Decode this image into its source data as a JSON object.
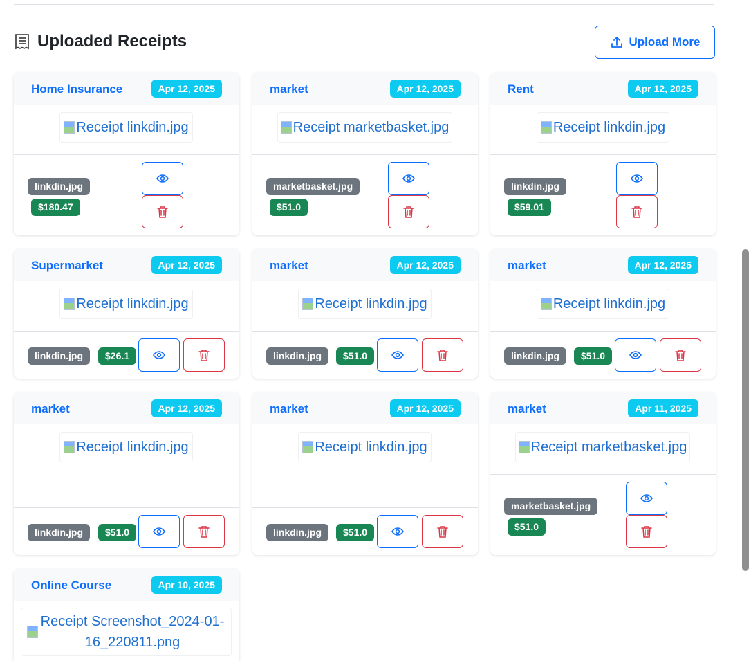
{
  "header": {
    "title": "Uploaded Receipts",
    "upload_label": "Upload More"
  },
  "cards": [
    {
      "title": "Home Insurance",
      "date": "Apr 12, 2025",
      "image_alt": "Receipt linkdin.jpg",
      "file": "linkdin.jpg",
      "amount": "$180.47"
    },
    {
      "title": "market",
      "date": "Apr 12, 2025",
      "image_alt": "Receipt marketbasket.jpg",
      "file": "marketbasket.jpg",
      "amount": "$51.0"
    },
    {
      "title": "Rent",
      "date": "Apr 12, 2025",
      "image_alt": "Receipt linkdin.jpg",
      "file": "linkdin.jpg",
      "amount": "$59.01"
    },
    {
      "title": "Supermarket",
      "date": "Apr 12, 2025",
      "image_alt": "Receipt linkdin.jpg",
      "file": "linkdin.jpg",
      "amount": "$26.1"
    },
    {
      "title": "market",
      "date": "Apr 12, 2025",
      "image_alt": "Receipt linkdin.jpg",
      "file": "linkdin.jpg",
      "amount": "$51.0"
    },
    {
      "title": "market",
      "date": "Apr 12, 2025",
      "image_alt": "Receipt linkdin.jpg",
      "file": "linkdin.jpg",
      "amount": "$51.0"
    },
    {
      "title": "market",
      "date": "Apr 12, 2025",
      "image_alt": "Receipt linkdin.jpg",
      "file": "linkdin.jpg",
      "amount": "$51.0"
    },
    {
      "title": "market",
      "date": "Apr 12, 2025",
      "image_alt": "Receipt linkdin.jpg",
      "file": "linkdin.jpg",
      "amount": "$51.0"
    },
    {
      "title": "market",
      "date": "Apr 11, 2025",
      "image_alt": "Receipt marketbasket.jpg",
      "file": "marketbasket.jpg",
      "amount": "$51.0"
    },
    {
      "title": "Online Course",
      "date": "Apr 10, 2025",
      "image_alt": "Receipt Screenshot_2024-01-16_220811.png"
    }
  ],
  "icons": {
    "section": "receipt-icon",
    "upload": "upload-icon",
    "view": "eye-icon",
    "delete": "trash-icon",
    "broken_image": "broken-image-icon"
  },
  "colors": {
    "primary": "#0d6efd",
    "info": "#0dcaf0",
    "success": "#198754",
    "secondary": "#6c757d",
    "danger": "#dc3545"
  }
}
